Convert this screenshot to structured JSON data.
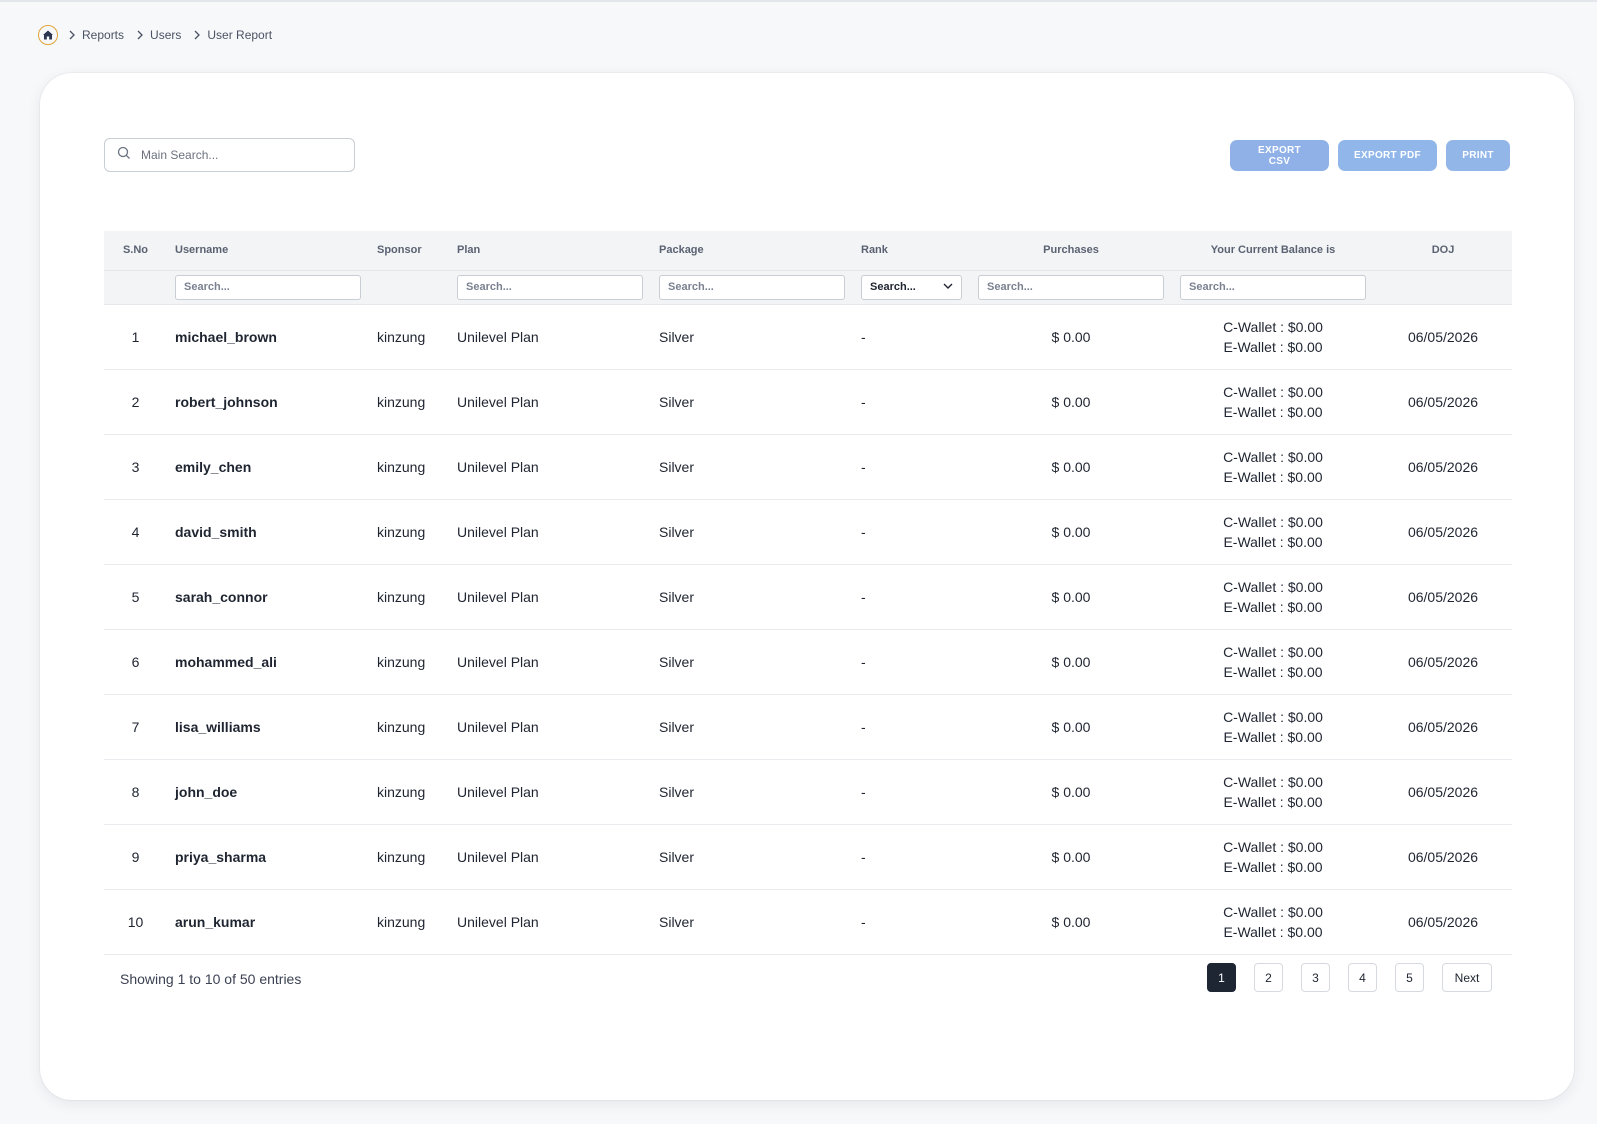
{
  "breadcrumb": {
    "items": [
      "Reports",
      "Users",
      "User Report"
    ]
  },
  "search": {
    "placeholder": "Main Search..."
  },
  "toolbar": {
    "export_csv": "EXPORT CSV",
    "export_pdf": "EXPORT PDF",
    "print": "PRINT"
  },
  "table": {
    "headers": {
      "sno": "S.No",
      "username": "Username",
      "sponsor": "Sponsor",
      "plan": "Plan",
      "package": "Package",
      "rank": "Rank",
      "purchases": "Purchases",
      "balance": "Your Current Balance is",
      "doj": "DOJ"
    },
    "filter_placeholder": "Search...",
    "rank_select_value": "Search...",
    "rows": [
      {
        "sno": "1",
        "username": "michael_brown",
        "sponsor": "kinzung",
        "plan": "Unilevel Plan",
        "package": "Silver",
        "rank": "-",
        "purchases": "$ 0.00",
        "cwallet": "C-Wallet : $0.00",
        "ewallet": "E-Wallet : $0.00",
        "doj": "06/05/2026"
      },
      {
        "sno": "2",
        "username": "robert_johnson",
        "sponsor": "kinzung",
        "plan": "Unilevel Plan",
        "package": "Silver",
        "rank": "-",
        "purchases": "$ 0.00",
        "cwallet": "C-Wallet : $0.00",
        "ewallet": "E-Wallet : $0.00",
        "doj": "06/05/2026"
      },
      {
        "sno": "3",
        "username": "emily_chen",
        "sponsor": "kinzung",
        "plan": "Unilevel Plan",
        "package": "Silver",
        "rank": "-",
        "purchases": "$ 0.00",
        "cwallet": "C-Wallet : $0.00",
        "ewallet": "E-Wallet : $0.00",
        "doj": "06/05/2026"
      },
      {
        "sno": "4",
        "username": "david_smith",
        "sponsor": "kinzung",
        "plan": "Unilevel Plan",
        "package": "Silver",
        "rank": "-",
        "purchases": "$ 0.00",
        "cwallet": "C-Wallet : $0.00",
        "ewallet": "E-Wallet : $0.00",
        "doj": "06/05/2026"
      },
      {
        "sno": "5",
        "username": "sarah_connor",
        "sponsor": "kinzung",
        "plan": "Unilevel Plan",
        "package": "Silver",
        "rank": "-",
        "purchases": "$ 0.00",
        "cwallet": "C-Wallet : $0.00",
        "ewallet": "E-Wallet : $0.00",
        "doj": "06/05/2026"
      },
      {
        "sno": "6",
        "username": "mohammed_ali",
        "sponsor": "kinzung",
        "plan": "Unilevel Plan",
        "package": "Silver",
        "rank": "-",
        "purchases": "$ 0.00",
        "cwallet": "C-Wallet : $0.00",
        "ewallet": "E-Wallet : $0.00",
        "doj": "06/05/2026"
      },
      {
        "sno": "7",
        "username": "lisa_williams",
        "sponsor": "kinzung",
        "plan": "Unilevel Plan",
        "package": "Silver",
        "rank": "-",
        "purchases": "$ 0.00",
        "cwallet": "C-Wallet : $0.00",
        "ewallet": "E-Wallet : $0.00",
        "doj": "06/05/2026"
      },
      {
        "sno": "8",
        "username": "john_doe",
        "sponsor": "kinzung",
        "plan": "Unilevel Plan",
        "package": "Silver",
        "rank": "-",
        "purchases": "$ 0.00",
        "cwallet": "C-Wallet : $0.00",
        "ewallet": "E-Wallet : $0.00",
        "doj": "06/05/2026"
      },
      {
        "sno": "9",
        "username": "priya_sharma",
        "sponsor": "kinzung",
        "plan": "Unilevel Plan",
        "package": "Silver",
        "rank": "-",
        "purchases": "$ 0.00",
        "cwallet": "C-Wallet : $0.00",
        "ewallet": "E-Wallet : $0.00",
        "doj": "06/05/2026"
      },
      {
        "sno": "10",
        "username": "arun_kumar",
        "sponsor": "kinzung",
        "plan": "Unilevel Plan",
        "package": "Silver",
        "rank": "-",
        "purchases": "$ 0.00",
        "cwallet": "C-Wallet : $0.00",
        "ewallet": "E-Wallet : $0.00",
        "doj": "06/05/2026"
      }
    ]
  },
  "footer": {
    "showing": "Showing 1 to 10 of 50 entries",
    "pages": [
      "1",
      "2",
      "3",
      "4",
      "5"
    ],
    "active_page": "1",
    "next": "Next"
  },
  "icons": {
    "home": "home-icon",
    "search": "search-icon",
    "separator": "chevron-right-icon",
    "dropdown": "chevron-down-icon"
  },
  "colors": {
    "accent_button": "#8fb1e7",
    "active_page": "#1e2533",
    "home_ring": "#e0a53a"
  }
}
